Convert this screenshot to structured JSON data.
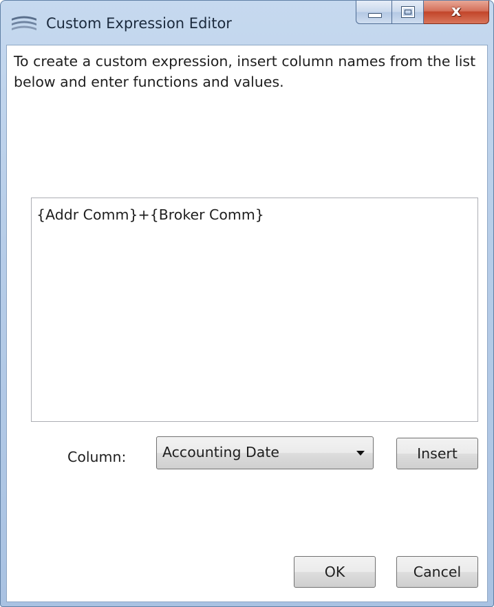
{
  "window": {
    "title": "Custom Expression Editor",
    "caption_buttons": {
      "close_glyph": "x"
    }
  },
  "instruction": "To create a custom expression, insert column names from the list below and enter functions and values.",
  "expression": {
    "value": "{Addr Comm}+{Broker Comm}"
  },
  "column": {
    "label": "Column:",
    "selected": "Accounting Date"
  },
  "buttons": {
    "insert": "Insert",
    "ok": "OK",
    "cancel": "Cancel"
  },
  "icons": {
    "app": "app-logo-icon",
    "minimize": "minimize-icon",
    "maximize": "maximize-icon",
    "close": "close-icon",
    "dropdown": "chevron-down-icon"
  },
  "colors": {
    "titlebar": "#b7cde8",
    "close_button": "#c2452a"
  }
}
